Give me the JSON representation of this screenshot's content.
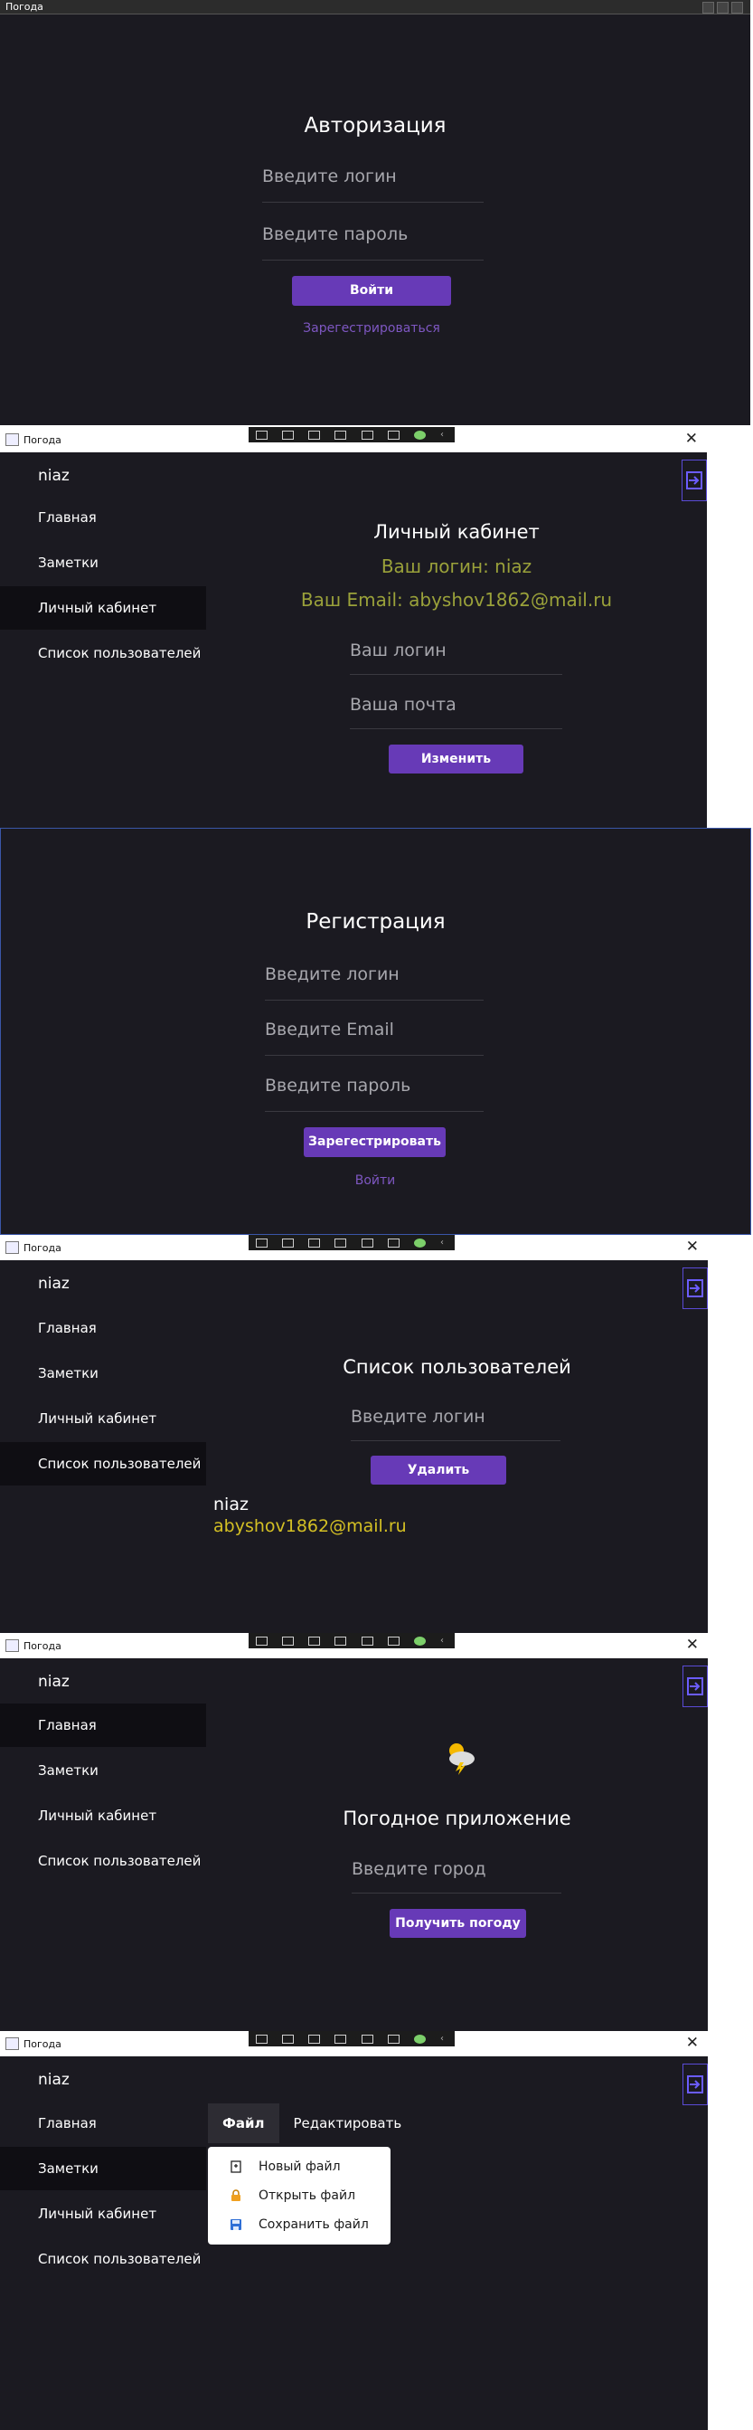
{
  "window": {
    "title": "Погода"
  },
  "login": {
    "heading": "Авторизация",
    "login_placeholder": "Введите логин",
    "password_placeholder": "Введите пароль",
    "submit_label": "Войти",
    "register_link": "Зарегестрироваться"
  },
  "nav": {
    "username": "niaz",
    "items": [
      "Главная",
      "Заметки",
      "Личный кабинет",
      "Список пользователей"
    ]
  },
  "profile": {
    "heading": "Личный кабинет",
    "login_line": "Ваш логин: niaz",
    "email_line": "Ваш Email: abyshov1862@mail.ru",
    "login_field": "Ваш логин",
    "email_field": "Ваша почта",
    "change_label": "Изменить"
  },
  "register": {
    "heading": "Регистрация",
    "login_placeholder": "Введите логин",
    "email_placeholder": "Введите Email",
    "password_placeholder": "Введите пароль",
    "submit_label": "Зарегестрировать",
    "login_link": "Войти"
  },
  "users": {
    "heading": "Список пользователей",
    "login_placeholder": "Введите логин",
    "delete_label": "Удалить",
    "entries": [
      {
        "name": "niaz",
        "email": "abyshov1862@mail.ru"
      }
    ]
  },
  "weather": {
    "heading": "Погодное приложение",
    "city_placeholder": "Введите город",
    "submit_label": "Получить погоду"
  },
  "notes": {
    "menu": [
      "Файл",
      "Редактировать"
    ],
    "file_menu": [
      "Новый файл",
      "Открыть файл",
      "Сохранить файл"
    ]
  },
  "colors": {
    "background": "#1b1a21",
    "accent": "#673ab7",
    "info_text": "#9aa13a",
    "email_text": "#d4c024"
  }
}
